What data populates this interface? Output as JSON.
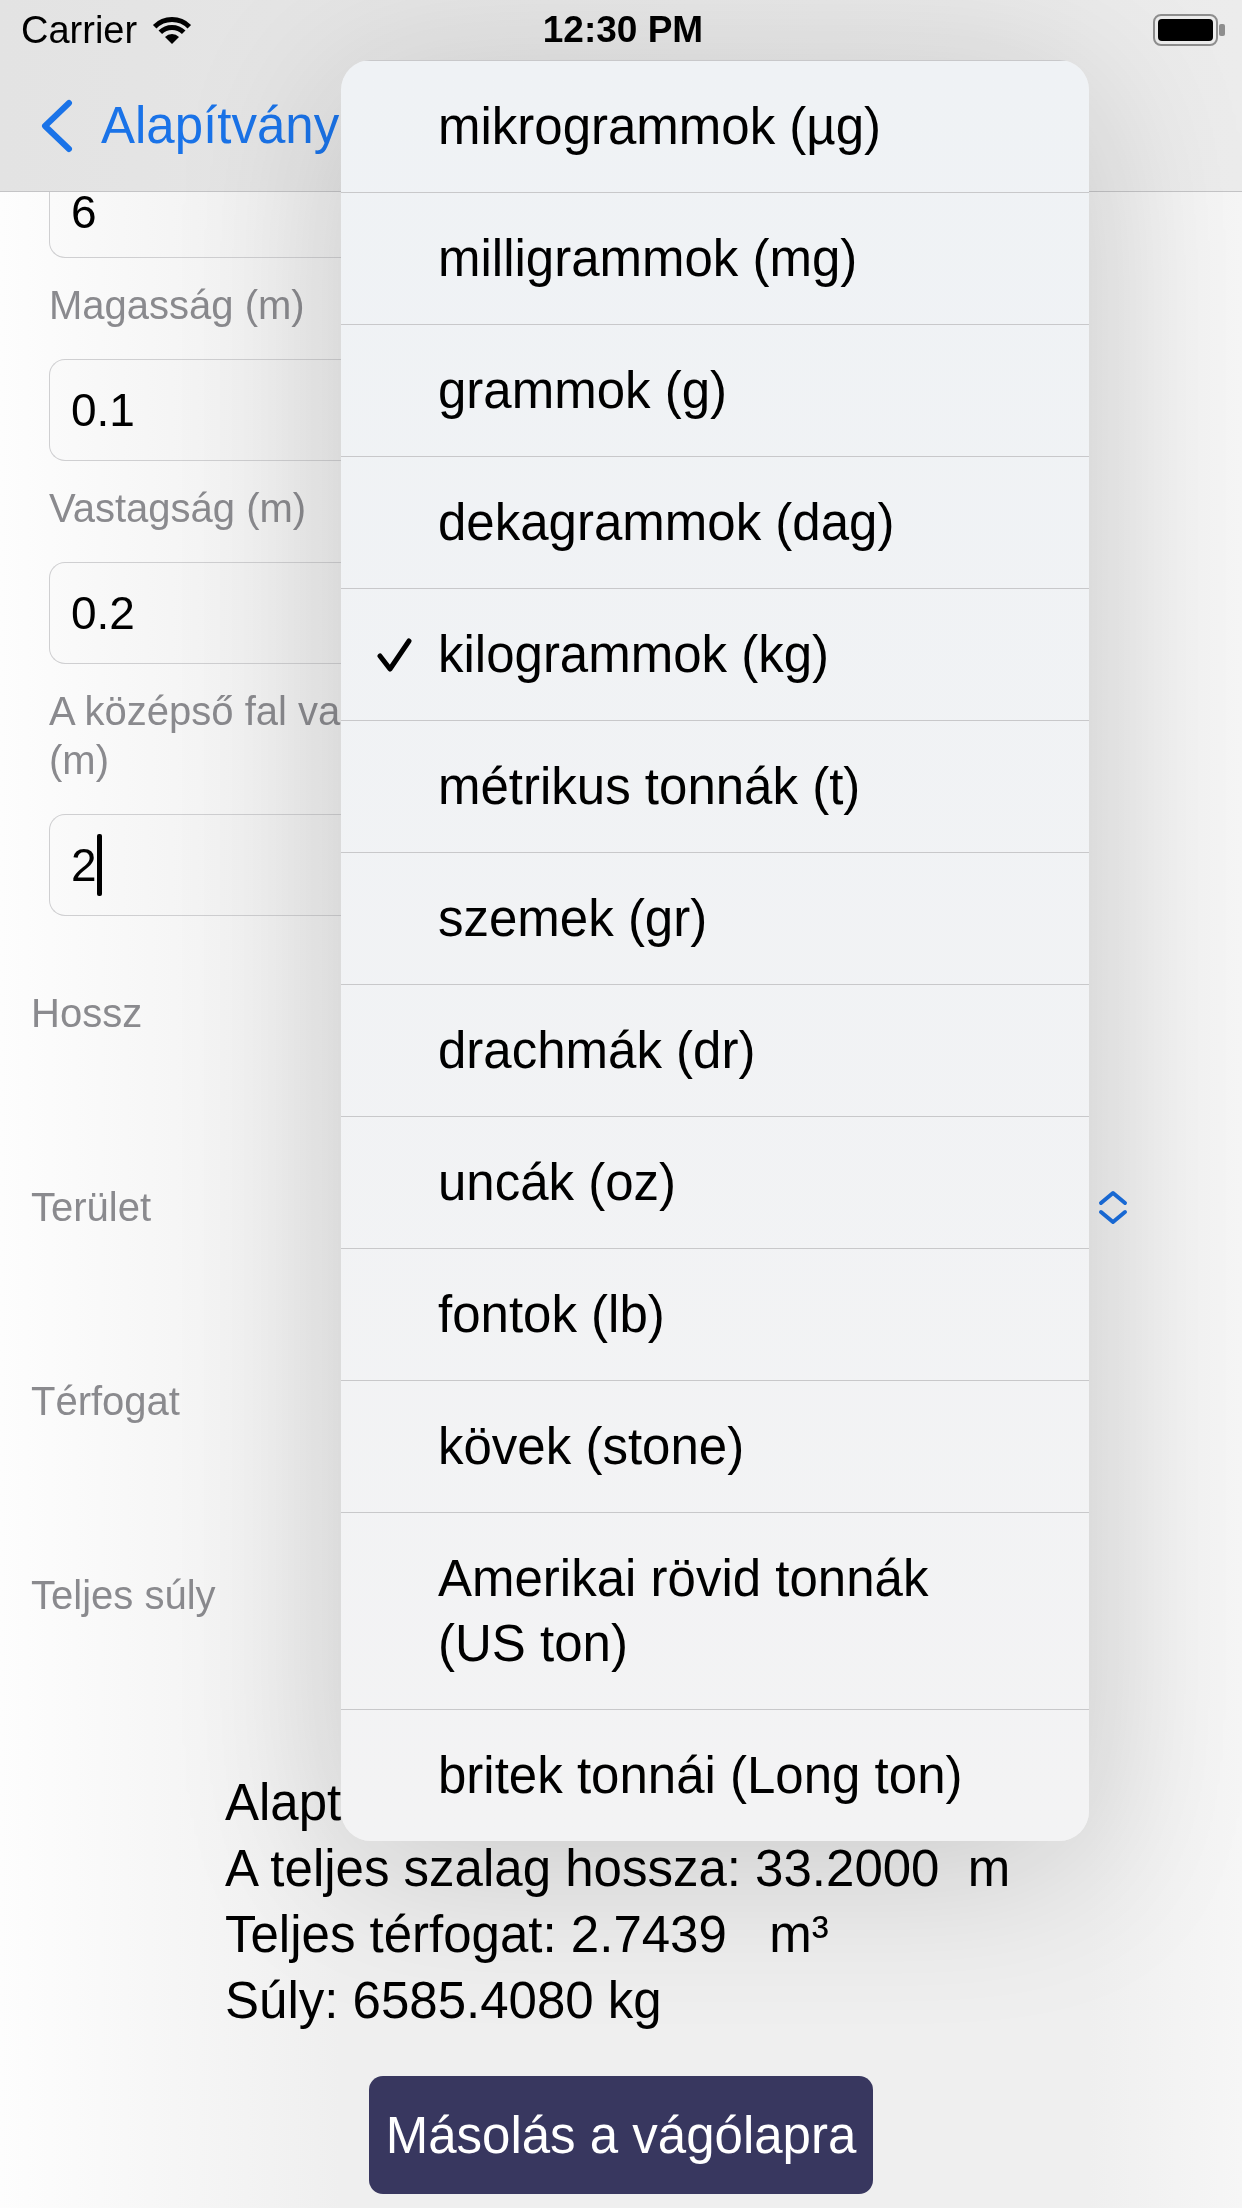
{
  "status_bar": {
    "carrier": "Carrier",
    "time": "12:30 PM"
  },
  "nav_bar": {
    "back_label": "Alapítvány"
  },
  "form": {
    "fields": [
      {
        "value": "6",
        "focused": false
      },
      {
        "label": "Magasság (m)",
        "value": "0.1",
        "focused": false
      },
      {
        "label": "Vastagság (m)",
        "value": "0.2",
        "focused": false
      },
      {
        "label": "A középső fal va\n(m)",
        "value": "2",
        "focused": true
      }
    ],
    "rows": [
      {
        "label": "Hossz",
        "kind": "plain"
      },
      {
        "label": "Terület",
        "kind": "picker"
      },
      {
        "label": "Térfogat",
        "kind": "plain"
      },
      {
        "label": "Teljes súly",
        "kind": "plain"
      }
    ]
  },
  "results": [
    "Alapt",
    "A teljes szalag hossza: 33.2000  m",
    "Teljes térfogat: 2.7439   m³",
    "Súly: 6585.4080 kg"
  ],
  "copy_button": "Másolás a vágólapra",
  "unit_menu": {
    "items": [
      {
        "label": "mikrogrammok (µg)",
        "selected": false
      },
      {
        "label": "milligrammok (mg)",
        "selected": false
      },
      {
        "label": "grammok (g)",
        "selected": false
      },
      {
        "label": "dekagrammok (dag)",
        "selected": false
      },
      {
        "label": "kilogrammok (kg)",
        "selected": true
      },
      {
        "label": "métrikus tonnák (t)",
        "selected": false
      },
      {
        "label": "szemek (gr)",
        "selected": false
      },
      {
        "label": "drachmák (dr)",
        "selected": false
      },
      {
        "label": "uncák (oz)",
        "selected": false
      },
      {
        "label": "fontok (lb)",
        "selected": false
      },
      {
        "label": "kövek (stone)",
        "selected": false
      },
      {
        "label": "Amerikai rövid tonnák (US ton)",
        "selected": false
      },
      {
        "label": "britek tonnái (Long ton)",
        "selected": false
      }
    ]
  }
}
